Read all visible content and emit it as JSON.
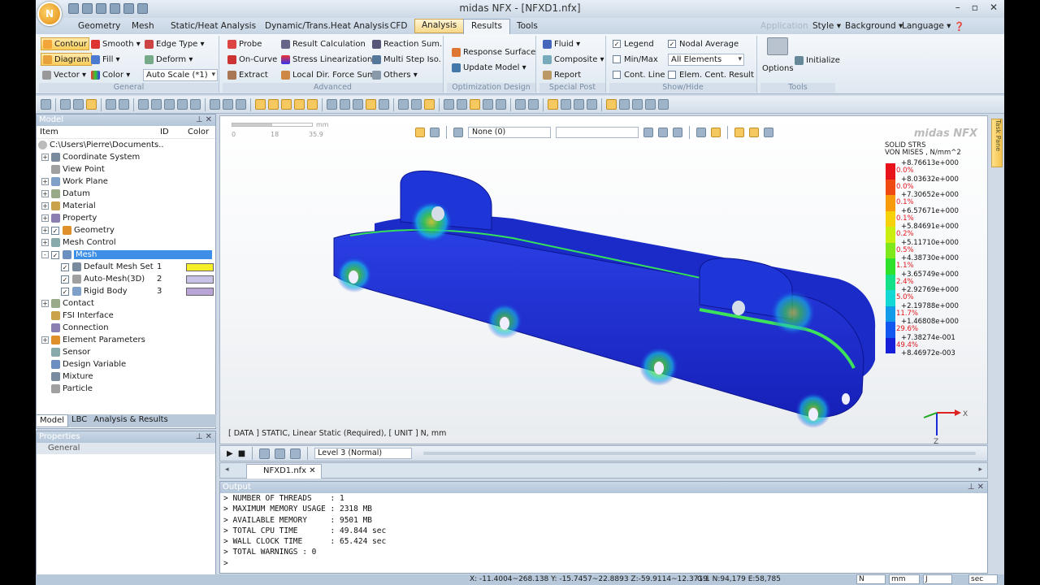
{
  "window": {
    "title": "midas NFX - [NFXD1.nfx]",
    "logo": "N"
  },
  "tabs": [
    "Geometry",
    "Mesh",
    "Static/Heat Analysis",
    "Dynamic/Trans.Heat Analysis",
    "CFD",
    "Analysis",
    "Results",
    "Tools"
  ],
  "right_menu": {
    "application": "Application",
    "style": "Style ▾",
    "background": "Background ▾",
    "language": "Language ▾"
  },
  "ribbon": {
    "general": {
      "label": "General",
      "contour": "Contour",
      "smooth": "Smooth ▾",
      "edge_type": "Edge Type ▾",
      "diagram": "Diagram",
      "fill": "Fill ▾",
      "deform": "Deform ▾",
      "vector": "Vector ▾",
      "color": "Color ▾",
      "autoscale": "Auto Scale (*1)"
    },
    "advanced": {
      "label": "Advanced",
      "probe": "Probe",
      "result_calc": "Result Calculation",
      "reaction_sum": "Reaction Sum.",
      "on_curve": "On-Curve",
      "stress_lin": "Stress Linearization",
      "multi_step": "Multi Step Iso.",
      "extract": "Extract",
      "local_dir": "Local Dir. Force Sum",
      "others": "Others ▾"
    },
    "optimization": {
      "label": "Optimization Design",
      "response_surface": "Response Surface",
      "update_model": "Update Model ▾"
    },
    "special_post": {
      "label": "Special Post",
      "fluid": "Fluid ▾",
      "composite": "Composite ▾",
      "report": "Report"
    },
    "show_hide": {
      "label": "Show/Hide",
      "legend": "Legend",
      "nodal_average": "Nodal Average",
      "minmax": "Min/Max",
      "all_elements": "All Elements",
      "cont_line": "Cont. Line",
      "elem_cent": "Elem. Cent. Result"
    },
    "tools": {
      "label": "Tools",
      "options": "Options",
      "initialize": "Initialize"
    }
  },
  "model_panel": {
    "title": "Model",
    "col_item": "Item",
    "col_id": "ID",
    "col_color": "Color",
    "root": "C:\\Users\\Pierre\\Documents..",
    "items": [
      {
        "label": "Coordinate System",
        "exp": "+",
        "check": false
      },
      {
        "label": "View Point",
        "exp": "",
        "check": false
      },
      {
        "label": "Work Plane",
        "exp": "+",
        "check": false
      },
      {
        "label": "Datum",
        "exp": "+",
        "check": false
      },
      {
        "label": "Material",
        "exp": "+",
        "check": false
      },
      {
        "label": "Property",
        "exp": "+",
        "check": false
      },
      {
        "label": "Geometry",
        "exp": "+",
        "check": true
      },
      {
        "label": "Mesh Control",
        "exp": "+",
        "check": false
      },
      {
        "label": "Mesh",
        "exp": "-",
        "check": true
      },
      {
        "label": "Default Mesh Set",
        "id": "1",
        "color": "#f7ee2a",
        "sub": true
      },
      {
        "label": "Auto-Mesh(3D)",
        "id": "2",
        "color": "#c9c2e6",
        "sub": true
      },
      {
        "label": "Rigid Body",
        "id": "3",
        "color": "#b9a4d8",
        "sub": true
      },
      {
        "label": "Contact",
        "exp": "+",
        "check": false
      },
      {
        "label": "FSI Interface",
        "exp": "",
        "check": false
      },
      {
        "label": "Connection",
        "exp": "",
        "check": false
      },
      {
        "label": "Element Parameters",
        "exp": "+",
        "check": false
      },
      {
        "label": "Sensor",
        "exp": "",
        "check": false
      },
      {
        "label": "Design Variable",
        "exp": "",
        "check": false
      },
      {
        "label": "Mixture",
        "exp": "",
        "check": false
      },
      {
        "label": "Particle",
        "exp": "",
        "check": false
      }
    ]
  },
  "bottom_tabs": [
    "Model",
    "LBC",
    "Analysis & Results"
  ],
  "properties": {
    "title": "Properties",
    "general": "General"
  },
  "viewport": {
    "mode": "None (0)",
    "scale_unit": "mm",
    "scale_ticks": [
      "0",
      "18",
      "35.9"
    ],
    "data_info": "[ DATA ]  STATIC, Linear Static (Required),   [ UNIT ]   N, mm"
  },
  "legend": {
    "brand": "midas NFX",
    "title1": "SOLID STRS",
    "title2": "VON MISES , N/mm^2",
    "values": [
      "+8.76613e+000",
      "+8.03632e+000",
      "+7.30652e+000",
      "+6.57671e+000",
      "+5.84691e+000",
      "+5.11710e+000",
      "+4.38730e+000",
      "+3.65749e+000",
      "+2.92769e+000",
      "+2.19788e+000",
      "+1.46808e+000",
      "+7.38274e-001",
      "+8.46972e-003"
    ],
    "percents": [
      "0.0%",
      "0.0%",
      "0.1%",
      "0.1%",
      "0.2%",
      "0.5%",
      "1.1%",
      "2.4%",
      "5.0%",
      "11.7%",
      "29.6%",
      "49.4%"
    ],
    "colors": [
      "#e8121a",
      "#f04a12",
      "#f79a0c",
      "#f7d10a",
      "#c9ee10",
      "#7fe81b",
      "#2ee12a",
      "#14e08a",
      "#13d8d4",
      "#129be8",
      "#1257f0",
      "#1720d8"
    ]
  },
  "triad": {
    "x": "X",
    "z": "Z"
  },
  "anim": {
    "level": "Level 3 (Normal)"
  },
  "doc_tab": "NFXD1.nfx",
  "output": {
    "title": "Output",
    "lines": [
      "> NUMBER OF THREADS    : 1",
      "> MAXIMUM MEMORY USAGE : 2318 MB",
      "> AVAILABLE MEMORY     : 9501 MB",
      "> TOTAL CPU TIME       : 49.844 sec",
      "> WALL CLOCK TIME      : 65.424 sec",
      "> TOTAL WARNINGS : 0",
      ">"
    ]
  },
  "status": {
    "coords": "X: -11.4004~268.138 Y: -15.7457~22.8893 Z:-59.9114~12.3719",
    "g": "G:1 N:94,179 E:58,785",
    "unit_force": "N",
    "unit_len": "mm",
    "unit_energy": "J",
    "unit_time": "sec"
  },
  "task_pane": "Task Pane"
}
